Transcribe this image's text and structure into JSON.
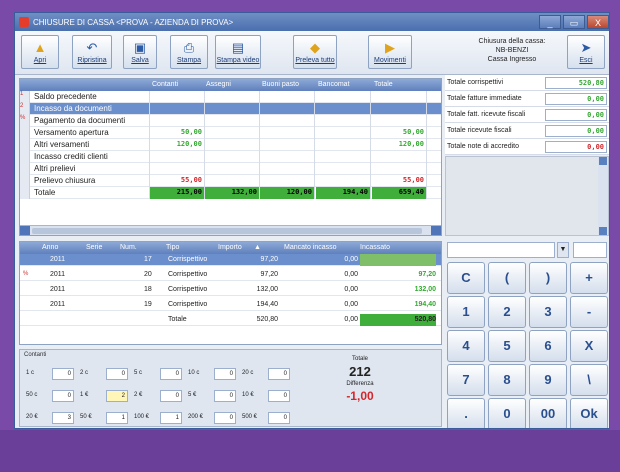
{
  "window": {
    "title": "CHIUSURE DI CASSA <PROVA - AZIENDA DI PROVA>",
    "controls": [
      "_",
      "▭",
      "X"
    ]
  },
  "toolbar": {
    "buttons": [
      {
        "label": "Apri",
        "icon": "folder-open-icon"
      },
      {
        "label": "Ripristina",
        "icon": "undo-icon"
      },
      {
        "label": "Salva",
        "icon": "save-icon"
      },
      {
        "label": "Stampa",
        "icon": "printer-icon"
      },
      {
        "label": "Stampa video",
        "icon": "monitor-icon"
      },
      {
        "label": "Preleva tutto",
        "icon": "withdraw-icon"
      },
      {
        "label": "Movimenti",
        "icon": "movements-icon"
      },
      {
        "label": "Esci",
        "icon": "exit-icon"
      }
    ],
    "info": {
      "line1": "Chiusura della cassa:",
      "line2": "NB-BENZI",
      "line3": "Cassa Ingresso"
    }
  },
  "main_table": {
    "columns": [
      "Contanti",
      "Assegni",
      "Buoni pasto",
      "Bancomat",
      "Totale"
    ],
    "rows": [
      {
        "label": "Saldo precedente",
        "values": [
          "",
          "",
          "",
          "",
          ""
        ]
      },
      {
        "label": "Incasso da documenti",
        "values": [
          "",
          "",
          "",
          "",
          ""
        ],
        "selected": true
      },
      {
        "label": "Pagamento da documenti",
        "values": [
          "",
          "",
          "",
          "",
          ""
        ]
      },
      {
        "label": "Versamento apertura",
        "values": [
          "50,00",
          "",
          "",
          "",
          "50,00"
        ]
      },
      {
        "label": "Altri versamenti",
        "values": [
          "120,00",
          "",
          "",
          "",
          "120,00"
        ]
      },
      {
        "label": "Incasso crediti clienti",
        "values": [
          "",
          "",
          "",
          "",
          ""
        ]
      },
      {
        "label": "Altri prelievi",
        "values": [
          "",
          "",
          "",
          "",
          ""
        ]
      },
      {
        "label": "Prelievo chiusura",
        "values": [
          "55,00",
          "",
          "",
          "",
          "55,00"
        ]
      },
      {
        "label": "Totale",
        "values": [
          "215,00",
          "132,00",
          "120,00",
          "194,40",
          "659,40"
        ]
      }
    ],
    "row_markers": [
      "1",
      "2",
      "%"
    ]
  },
  "totals": [
    {
      "label": "Totale corrispettivi",
      "value": "520,80"
    },
    {
      "label": "Totale fatture immediate",
      "value": "0,00"
    },
    {
      "label": "Totale fatt. ricevute fiscali",
      "value": "0,00"
    },
    {
      "label": "Totale ricevute fiscali",
      "value": "0,00"
    },
    {
      "label": "Totale note di accredito",
      "value": "0,00"
    }
  ],
  "docs_table": {
    "columns": [
      "Anno",
      "Serie",
      "Num.",
      "Tipo",
      "Importo",
      "Mancato incasso",
      "Incassato"
    ],
    "rows": [
      {
        "anno": "2011",
        "serie": "",
        "num": "17",
        "tipo": "Corrispettivo",
        "importo": "97,20",
        "mancato": "0,00",
        "incassato": "",
        "selected": true
      },
      {
        "anno": "2011",
        "serie": "",
        "num": "20",
        "tipo": "Corrispettivo",
        "importo": "97,20",
        "mancato": "0,00",
        "incassato": "97,20"
      },
      {
        "anno": "2011",
        "serie": "",
        "num": "18",
        "tipo": "Corrispettivo",
        "importo": "132,00",
        "mancato": "0,00",
        "incassato": "132,00"
      },
      {
        "anno": "2011",
        "serie": "",
        "num": "19",
        "tipo": "Corrispettivo",
        "importo": "194,40",
        "mancato": "0,00",
        "incassato": "194,40"
      }
    ],
    "total": {
      "label": "Totale",
      "importo": "520,80",
      "mancato": "0,00",
      "incassato": "520,80"
    },
    "sort_indicator": "▲"
  },
  "contanti": {
    "title": "Contanti",
    "denominations": [
      [
        {
          "d": "1 c",
          "q": "0"
        },
        {
          "d": "2 c",
          "q": "0"
        },
        {
          "d": "5 c",
          "q": "0"
        },
        {
          "d": "10 c",
          "q": "0"
        },
        {
          "d": "20 c",
          "q": "0"
        }
      ],
      [
        {
          "d": "50 c",
          "q": "0"
        },
        {
          "d": "1 €",
          "q": "2"
        },
        {
          "d": "2 €",
          "q": "0"
        },
        {
          "d": "5 €",
          "q": "0"
        },
        {
          "d": "10 €",
          "q": "0"
        }
      ],
      [
        {
          "d": "20 €",
          "q": "3"
        },
        {
          "d": "50 €",
          "q": "1"
        },
        {
          "d": "100 €",
          "q": "1"
        },
        {
          "d": "200 €",
          "q": "0"
        },
        {
          "d": "500 €",
          "q": "0"
        }
      ]
    ],
    "totale_label": "Totale",
    "totale_value": "212",
    "differenza_label": "Differenza",
    "differenza_value": "-1,00"
  },
  "keypad": {
    "top_field": "",
    "top_dropdown": "",
    "keys": [
      [
        "C",
        "(",
        ")",
        "+"
      ],
      [
        "1",
        "2",
        "3",
        "-"
      ],
      [
        "4",
        "5",
        "6",
        "X"
      ],
      [
        "7",
        "8",
        "9",
        "\\"
      ],
      [
        ".",
        "0",
        "00",
        "Ok"
      ]
    ]
  }
}
